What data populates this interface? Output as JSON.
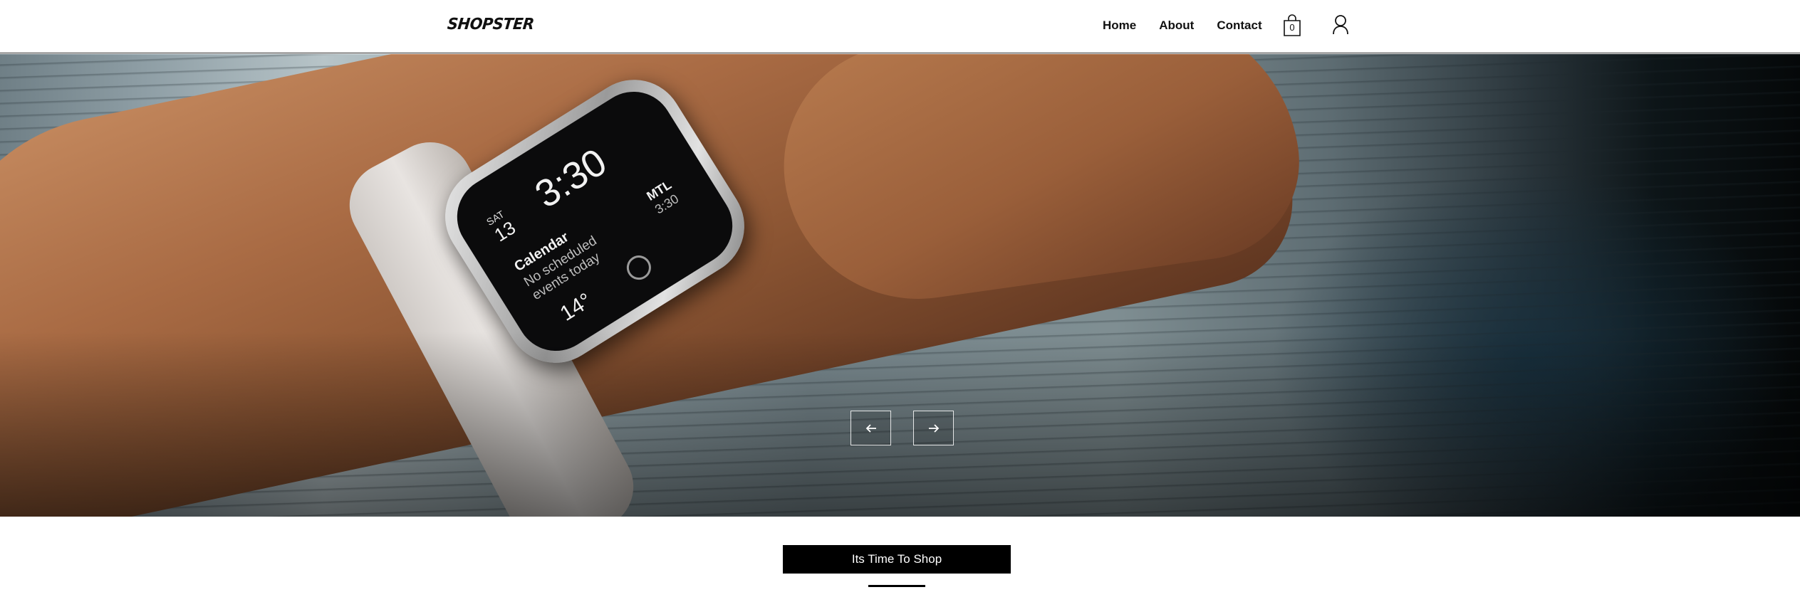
{
  "header": {
    "logo": "SHOPSTER",
    "nav": [
      {
        "label": "Home"
      },
      {
        "label": "About"
      },
      {
        "label": "Contact"
      }
    ],
    "cart_count": "0",
    "cart_icon": "shopping-bag-icon",
    "user_icon": "user-icon"
  },
  "hero": {
    "watch_screen": {
      "day": "SAT",
      "date": "13",
      "time": "3:30",
      "calendar_title": "Calendar",
      "calendar_note": "No scheduled events today",
      "temperature": "14°",
      "city": "MTL",
      "city_time": "3:30"
    },
    "prev_icon": "arrow-left-icon",
    "next_icon": "arrow-right-icon"
  },
  "cta": {
    "label": "Its Time To Shop"
  },
  "colors": {
    "header_bg": "#ffffff",
    "cta_bg": "#000000",
    "cta_text": "#ffffff"
  }
}
